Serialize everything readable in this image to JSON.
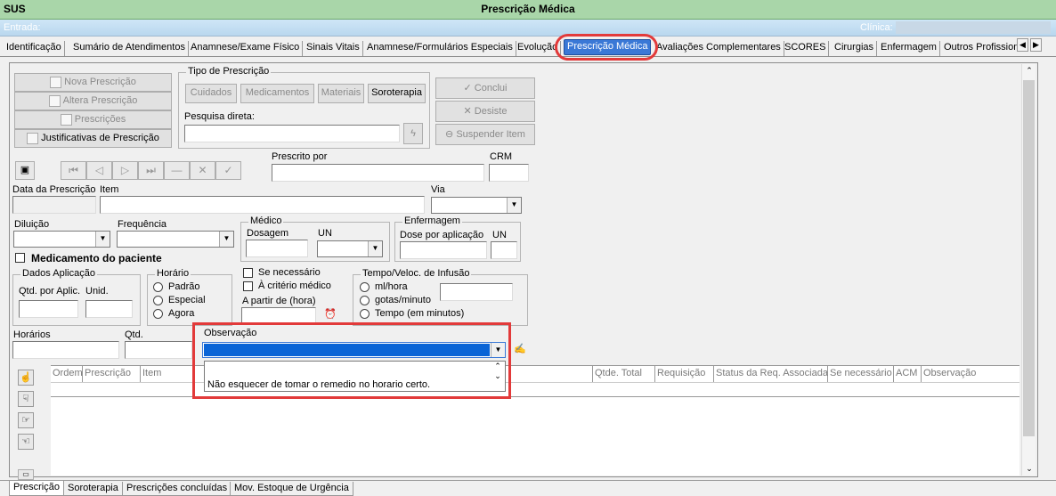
{
  "app": {
    "system": "SUS",
    "title": "Prescrição Médica"
  },
  "entrybar": {
    "entry_label": "Entrada:",
    "clinic_label": "Clínica: "
  },
  "tabs": [
    {
      "label": "Identificação"
    },
    {
      "label": "Sumário de Atendimentos"
    },
    {
      "label": "Anamnese/Exame Físico"
    },
    {
      "label": "Sinais Vitais"
    },
    {
      "label": "Anamnese/Formulários Especiais"
    },
    {
      "label": "Evolução"
    },
    {
      "label": "Prescrição Médica",
      "active": true
    },
    {
      "label": "Avaliações Complementares"
    },
    {
      "label": "SCORES"
    },
    {
      "label": "Cirurgias"
    },
    {
      "label": "Enfermagem"
    },
    {
      "label": "Outros Profission"
    }
  ],
  "left_actions": {
    "nova": "Nova Prescrição",
    "altera": "Altera Prescrição",
    "prescricoes": "Prescrições",
    "justificativas": "Justificativas de Prescrição"
  },
  "tipo": {
    "legend": "Tipo de Prescrição",
    "cuidados": "Cuidados",
    "medicamentos": "Medicamentos",
    "materiais": "Materiais",
    "soroterapia": "Soroterapia",
    "pesquisa_label": "Pesquisa direta:"
  },
  "actions": {
    "conclui": "Conclui",
    "desiste": "Desiste",
    "suspender": "Suspender Item"
  },
  "form": {
    "prescrito_por": "Prescrito por",
    "crm": "CRM",
    "data": "Data da Prescrição",
    "item": "Item",
    "via": "Via",
    "diluicao": "Diluição",
    "frequencia": "Frequência",
    "medico_legend": "Médico",
    "dosagem": "Dosagem",
    "un": "UN",
    "enf_legend": "Enfermagem",
    "dose_aplic": "Dose por aplicação",
    "un2": "UN",
    "med_paciente": "Medicamento do paciente",
    "dados_legend": "Dados Aplicação",
    "qtd_aplic": "Qtd. por Aplic.",
    "unid": "Unid.",
    "horario_legend": "Horário",
    "padrao": "Padrão",
    "especial": "Especial",
    "agora": "Agora",
    "se_necessario": "Se necessário",
    "criterio": "À critério médico",
    "a_partir": "A partir de (hora)",
    "tempo_legend": "Tempo/Veloc. de Infusão",
    "ml_hora": "ml/hora",
    "gotas": "gotas/minuto",
    "tempo_min": "Tempo (em minutos)",
    "horarios": "Horários",
    "qtd": "Qtd.",
    "observacao": "Observação"
  },
  "observacao_dropdown": {
    "option": "Não esquecer de tomar o remedio no horario certo."
  },
  "grid_headers": [
    "Ordem",
    "Prescrição",
    "Item",
    "Qtde. Total",
    "Requisição",
    "Status da Req. Associada",
    "Se necessário",
    "ACM",
    "Observação"
  ],
  "bottom_tabs": [
    {
      "label": "Prescrição",
      "active": true
    },
    {
      "label": "Soroterapia"
    },
    {
      "label": "Prescrições concluídas"
    },
    {
      "label": "Mov. Estoque de Urgência"
    }
  ]
}
